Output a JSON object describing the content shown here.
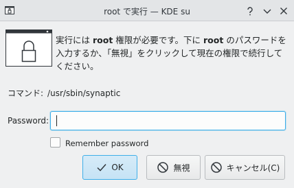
{
  "window": {
    "title": "root で実行 — KDE su"
  },
  "message": {
    "part1": "実行には ",
    "user1": "root",
    "part2": " 権限が必要です。下に ",
    "user2": "root",
    "part3": " のパスワードを入力するか、「無視」をクリックして現在の権限で続行してください。"
  },
  "command": {
    "label": "コマンド:",
    "value": "/usr/sbin/synaptic"
  },
  "password": {
    "label": "Password:",
    "value": ""
  },
  "remember": {
    "label": "Remember password",
    "checked": false
  },
  "buttons": {
    "ok": "OK",
    "ignore": "無視",
    "cancel": "キャンセル(C)"
  },
  "colors": {
    "accent": "#3daee9",
    "window_bg": "#eff0f1",
    "titlebar_bg": "#e3e5e7"
  }
}
